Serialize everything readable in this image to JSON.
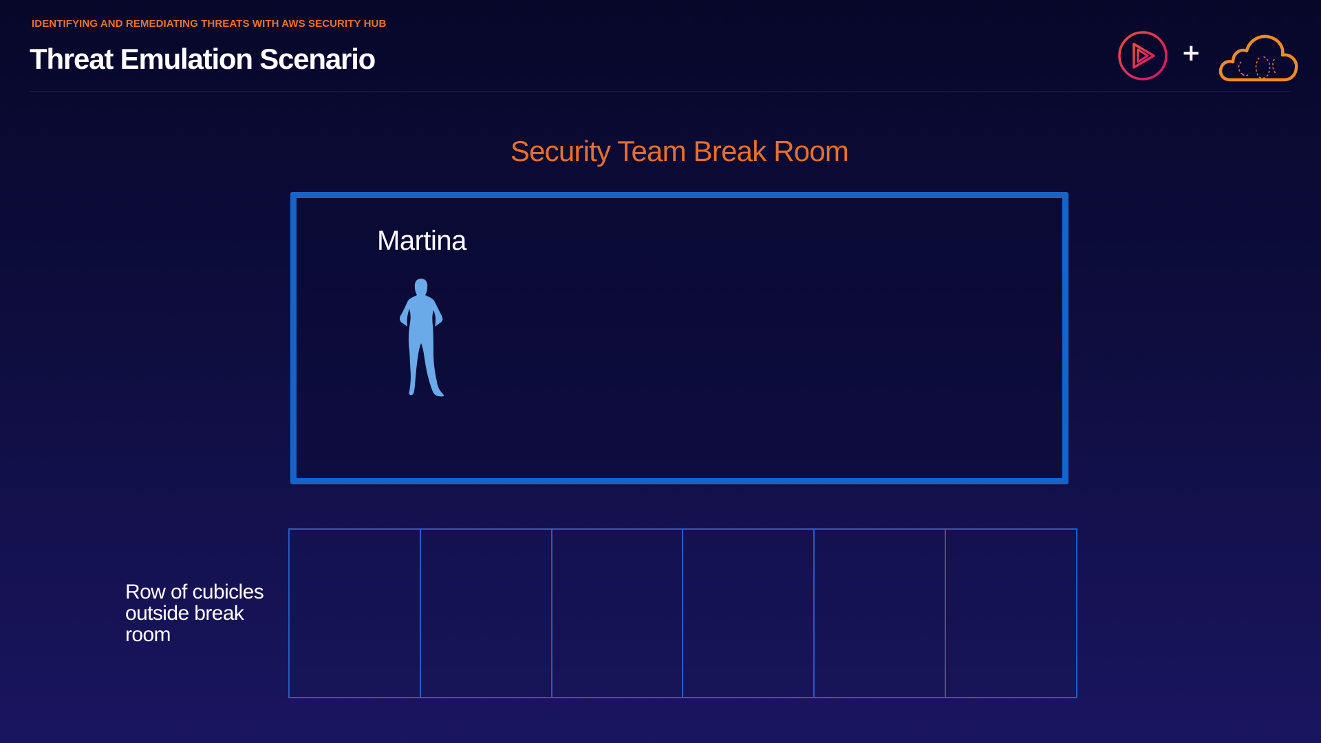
{
  "header": {
    "course_label": "IDENTIFYING AND REMEDIATING THREATS WITH AWS SECURITY HUB",
    "title": "Threat Emulation Scenario",
    "logos": {
      "left_icon": "pluralsight-play-icon",
      "separator": "+",
      "right_icon": "aws-cloud-icon"
    }
  },
  "scene": {
    "room_title": "Security Team Break Room",
    "person": {
      "name": "Martina",
      "icon": "person-silhouette-icon"
    },
    "cubicles": {
      "label": "Row of cubicles outside break room",
      "count": 6
    }
  },
  "colors": {
    "accent_orange": "#e8742a",
    "room_border_blue": "#1764c8",
    "cubicle_border_blue": "#1f5fc0",
    "figure_blue": "#6aaae8",
    "background": "#0e0d3e"
  }
}
